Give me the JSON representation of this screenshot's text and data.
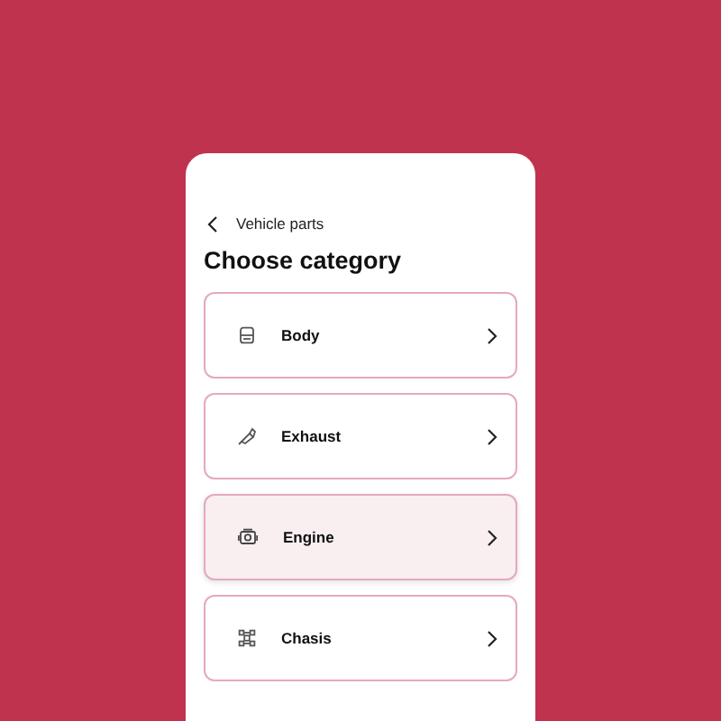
{
  "header": {
    "back_label": "Vehicle parts",
    "title": "Choose category"
  },
  "categories": [
    {
      "kind": "body",
      "label": "Body",
      "selected": false
    },
    {
      "kind": "exhaust",
      "label": "Exhaust",
      "selected": false
    },
    {
      "kind": "engine",
      "label": "Engine",
      "selected": true
    },
    {
      "kind": "chassis",
      "label": "Chasis",
      "selected": false
    }
  ]
}
